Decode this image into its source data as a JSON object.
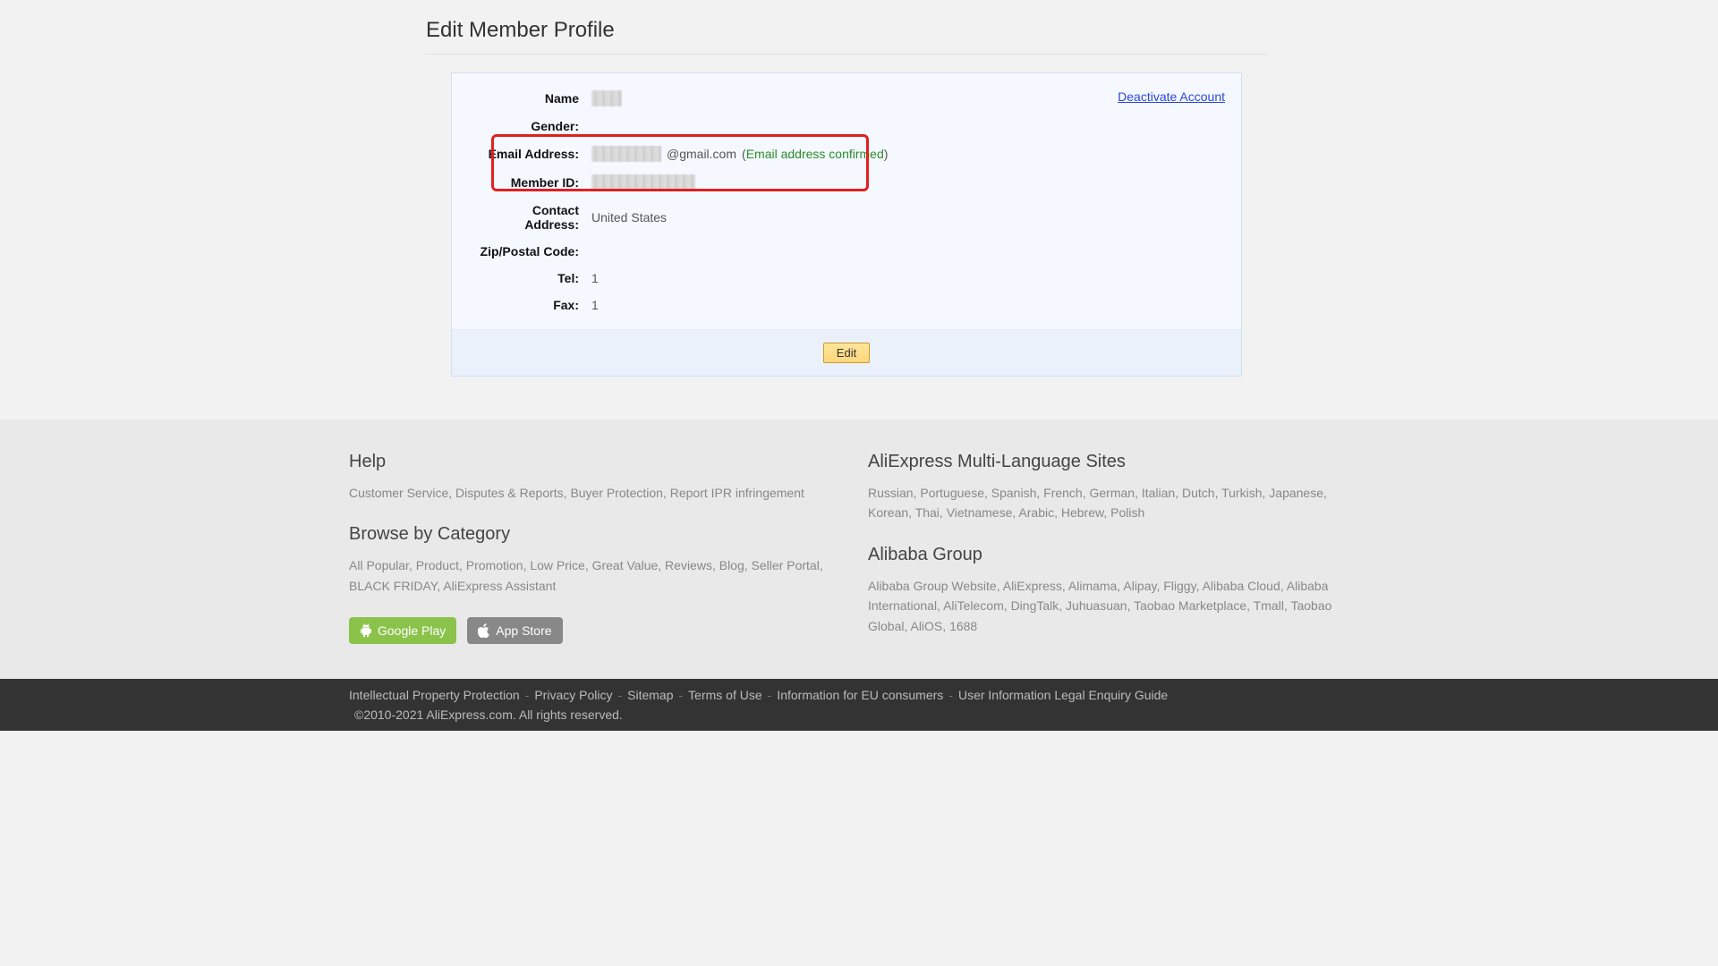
{
  "header": {
    "title": "Edit Member Profile"
  },
  "profile": {
    "deactivate_label": "Deactivate Account",
    "rows": {
      "name": {
        "label": "Name"
      },
      "gender": {
        "label": "Gender:"
      },
      "email": {
        "label": "Email Address:",
        "suffix": "@gmail.com",
        "confirmed_text": "Email address confirmed"
      },
      "member_id": {
        "label": "Member ID:"
      },
      "contact_address": {
        "label": "Contact Address:",
        "value": "United States"
      },
      "zip": {
        "label": "Zip/Postal Code:"
      },
      "tel": {
        "label": "Tel:",
        "value": "1"
      },
      "fax": {
        "label": "Fax:",
        "value": "1"
      }
    },
    "edit_button": "Edit"
  },
  "footer": {
    "help": {
      "heading": "Help",
      "links": [
        "Customer Service",
        "Disputes & Reports",
        "Buyer Protection",
        "Report IPR infringement"
      ]
    },
    "multilang": {
      "heading": "AliExpress Multi-Language Sites",
      "links": [
        "Russian",
        "Portuguese",
        "Spanish",
        "French",
        "German",
        "Italian",
        "Dutch",
        "Turkish",
        "Japanese",
        "Korean",
        "Thai",
        "Vietnamese",
        "Arabic",
        "Hebrew",
        "Polish"
      ]
    },
    "browse": {
      "heading": "Browse by Category",
      "links": [
        " All Popular",
        "Product",
        "Promotion",
        "Low Price",
        "Great Value",
        "Reviews",
        "Blog",
        "Seller Portal",
        "BLACK FRIDAY",
        "AliExpress Assistant"
      ]
    },
    "alibaba": {
      "heading": "Alibaba Group",
      "links": [
        "Alibaba Group Website",
        "AliExpress",
        "Alimama",
        "Alipay",
        "Fliggy",
        "Alibaba Cloud",
        "Alibaba International",
        "AliTelecom",
        "DingTalk",
        "Juhuasuan",
        "Taobao Marketplace",
        "Tmall",
        "Taobao Global",
        "AliOS",
        "1688"
      ]
    },
    "store": {
      "google_play": "Google Play",
      "app_store": "App Store"
    }
  },
  "bottom_bar": {
    "links": [
      "Intellectual Property Protection",
      "Privacy Policy",
      "Sitemap",
      "Terms of Use",
      "Information for EU consumers",
      "User Information Legal Enquiry Guide"
    ],
    "copyright": "©2010-2021 AliExpress.com. All rights reserved."
  }
}
